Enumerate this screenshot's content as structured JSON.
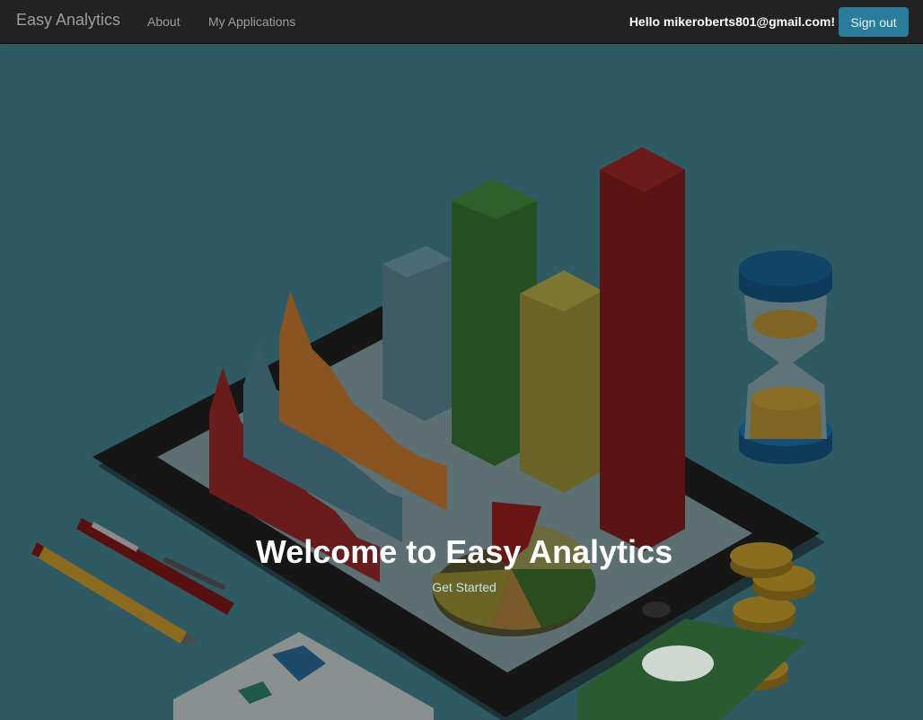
{
  "navbar": {
    "brand": "Easy Analytics",
    "links": [
      "About",
      "My Applications"
    ],
    "greeting": "Hello mikeroberts801@gmail.com!",
    "signout_label": "Sign out"
  },
  "hero": {
    "title": "Welcome to Easy Analytics",
    "cta": "Get Started"
  },
  "colors": {
    "navbar_bg": "#222222",
    "hero_bg": "#2e5b63",
    "signout_button": "#2a7d9a",
    "cta_link": "#bfe6f4"
  },
  "icons": [
    "illustration-analytics-isometric",
    "hourglass-icon",
    "coin-icon",
    "pen-icon",
    "pencil-icon",
    "dollar-bill-icon"
  ]
}
